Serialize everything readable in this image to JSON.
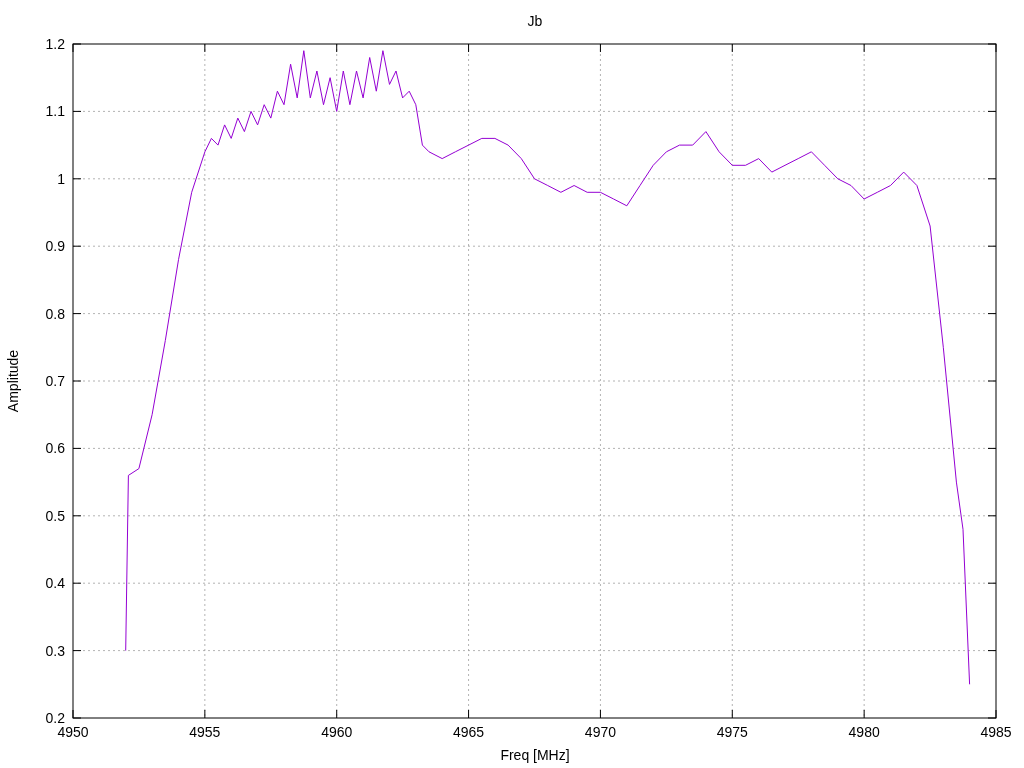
{
  "plot": {
    "chart_data": {
      "type": "line",
      "title": "Jb",
      "xlabel": "Freq [MHz]",
      "ylabel": "Amplitude",
      "grid": true,
      "xlim": [
        4950,
        4985
      ],
      "ylim": [
        0.2,
        1.2
      ],
      "xticks": [
        4950,
        4955,
        4960,
        4965,
        4970,
        4975,
        4980,
        4985
      ],
      "yticks": [
        0.2,
        0.3,
        0.4,
        0.5,
        0.6,
        0.7,
        0.8,
        0.9,
        1,
        1.1,
        1.2
      ],
      "x": [
        4952,
        4952.1,
        4952.5,
        4953,
        4953.5,
        4954,
        4954.5,
        4955,
        4955.25,
        4955.5,
        4955.75,
        4956,
        4956.25,
        4956.5,
        4956.75,
        4957,
        4957.25,
        4957.5,
        4957.75,
        4958,
        4958.25,
        4958.5,
        4958.75,
        4959,
        4959.25,
        4959.5,
        4959.75,
        4960,
        4960.25,
        4960.5,
        4960.75,
        4961,
        4961.25,
        4961.5,
        4961.75,
        4962,
        4962.25,
        4962.5,
        4962.75,
        4963,
        4963.25,
        4963.5,
        4964,
        4964.5,
        4965,
        4965.5,
        4966,
        4966.5,
        4967,
        4967.5,
        4968,
        4968.5,
        4969,
        4969.5,
        4970,
        4970.5,
        4971,
        4971.5,
        4972,
        4972.5,
        4973,
        4973.5,
        4974,
        4974.5,
        4975,
        4975.5,
        4976,
        4976.5,
        4977,
        4977.5,
        4978,
        4978.5,
        4979,
        4979.5,
        4980,
        4980.5,
        4981,
        4981.5,
        4982,
        4982.5,
        4983,
        4983.5,
        4983.75,
        4984
      ],
      "series": [
        {
          "color": "#9400d3",
          "values": [
            0.3,
            0.56,
            0.57,
            0.65,
            0.76,
            0.88,
            0.98,
            1.04,
            1.06,
            1.05,
            1.08,
            1.06,
            1.09,
            1.07,
            1.1,
            1.08,
            1.11,
            1.09,
            1.13,
            1.11,
            1.17,
            1.12,
            1.19,
            1.12,
            1.16,
            1.11,
            1.15,
            1.1,
            1.16,
            1.11,
            1.16,
            1.12,
            1.18,
            1.13,
            1.19,
            1.14,
            1.16,
            1.12,
            1.13,
            1.11,
            1.05,
            1.04,
            1.03,
            1.04,
            1.05,
            1.06,
            1.06,
            1.05,
            1.03,
            1.0,
            0.99,
            0.98,
            0.99,
            0.98,
            0.98,
            0.97,
            0.96,
            0.99,
            1.02,
            1.04,
            1.05,
            1.05,
            1.07,
            1.04,
            1.02,
            1.02,
            1.03,
            1.01,
            1.02,
            1.03,
            1.04,
            1.02,
            1.0,
            0.99,
            0.97,
            0.98,
            0.99,
            1.01,
            0.99,
            0.93,
            0.75,
            0.55,
            0.48,
            0.25
          ]
        }
      ]
    }
  }
}
